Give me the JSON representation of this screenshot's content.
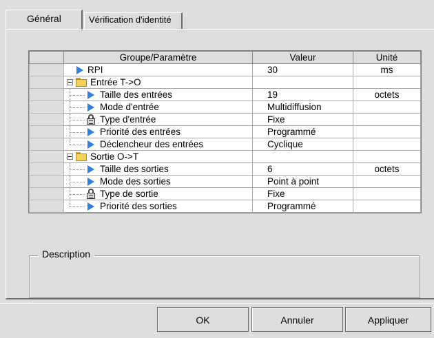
{
  "tabs": [
    {
      "label": "Général",
      "active": true
    },
    {
      "label": "Vérification d'identité",
      "active": false
    }
  ],
  "grid": {
    "columns": [
      "Groupe/Paramètre",
      "Valeur",
      "Unité"
    ],
    "rows": [
      {
        "name": "RPI",
        "value": "30",
        "unit": "ms",
        "icon": "arrow-icon",
        "kind": "top-param"
      },
      {
        "name": "Entrée T->O",
        "value": "",
        "unit": "",
        "icon": "folder-icon",
        "kind": "group"
      },
      {
        "name": "Taille des entrées",
        "value": "19",
        "unit": "octets",
        "icon": "arrow-icon",
        "kind": "child"
      },
      {
        "name": "Mode d'entrée",
        "value": "Multidiffusion",
        "unit": "",
        "icon": "arrow-icon",
        "kind": "child"
      },
      {
        "name": "Type d'entrée",
        "value": "Fixe",
        "unit": "",
        "icon": "lock-icon",
        "kind": "child"
      },
      {
        "name": "Priorité des entrées",
        "value": "Programmé",
        "unit": "",
        "icon": "arrow-icon",
        "kind": "child"
      },
      {
        "name": "Déclencheur des entrées",
        "value": "Cyclique",
        "unit": "",
        "icon": "arrow-icon",
        "kind": "child-last"
      },
      {
        "name": "Sortie O->T",
        "value": "",
        "unit": "",
        "icon": "folder-icon",
        "kind": "group"
      },
      {
        "name": "Taille des sorties",
        "value": "6",
        "unit": "octets",
        "icon": "arrow-icon",
        "kind": "child"
      },
      {
        "name": "Mode des sorties",
        "value": "Point à point",
        "unit": "",
        "icon": "arrow-icon",
        "kind": "child"
      },
      {
        "name": "Type de sortie",
        "value": "Fixe",
        "unit": "",
        "icon": "lock-icon",
        "kind": "child"
      },
      {
        "name": "Priorité des sorties",
        "value": "Programmé",
        "unit": "",
        "icon": "arrow-icon",
        "kind": "child-last"
      }
    ]
  },
  "description": {
    "label": "Description"
  },
  "buttons": {
    "ok": "OK",
    "cancel": "Annuler",
    "apply": "Appliquer"
  }
}
